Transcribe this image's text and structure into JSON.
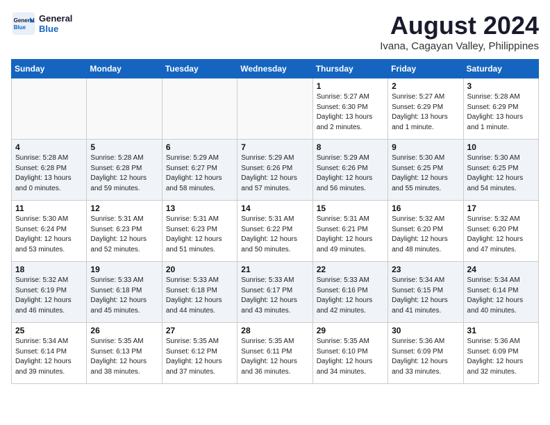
{
  "header": {
    "logo_line1": "General",
    "logo_line2": "Blue",
    "main_title": "August 2024",
    "subtitle": "Ivana, Cagayan Valley, Philippines"
  },
  "weekdays": [
    "Sunday",
    "Monday",
    "Tuesday",
    "Wednesday",
    "Thursday",
    "Friday",
    "Saturday"
  ],
  "weeks": [
    [
      {
        "day": "",
        "info": ""
      },
      {
        "day": "",
        "info": ""
      },
      {
        "day": "",
        "info": ""
      },
      {
        "day": "",
        "info": ""
      },
      {
        "day": "1",
        "info": "Sunrise: 5:27 AM\nSunset: 6:30 PM\nDaylight: 13 hours\nand 2 minutes."
      },
      {
        "day": "2",
        "info": "Sunrise: 5:27 AM\nSunset: 6:29 PM\nDaylight: 13 hours\nand 1 minute."
      },
      {
        "day": "3",
        "info": "Sunrise: 5:28 AM\nSunset: 6:29 PM\nDaylight: 13 hours\nand 1 minute."
      }
    ],
    [
      {
        "day": "4",
        "info": "Sunrise: 5:28 AM\nSunset: 6:28 PM\nDaylight: 13 hours\nand 0 minutes."
      },
      {
        "day": "5",
        "info": "Sunrise: 5:28 AM\nSunset: 6:28 PM\nDaylight: 12 hours\nand 59 minutes."
      },
      {
        "day": "6",
        "info": "Sunrise: 5:29 AM\nSunset: 6:27 PM\nDaylight: 12 hours\nand 58 minutes."
      },
      {
        "day": "7",
        "info": "Sunrise: 5:29 AM\nSunset: 6:26 PM\nDaylight: 12 hours\nand 57 minutes."
      },
      {
        "day": "8",
        "info": "Sunrise: 5:29 AM\nSunset: 6:26 PM\nDaylight: 12 hours\nand 56 minutes."
      },
      {
        "day": "9",
        "info": "Sunrise: 5:30 AM\nSunset: 6:25 PM\nDaylight: 12 hours\nand 55 minutes."
      },
      {
        "day": "10",
        "info": "Sunrise: 5:30 AM\nSunset: 6:25 PM\nDaylight: 12 hours\nand 54 minutes."
      }
    ],
    [
      {
        "day": "11",
        "info": "Sunrise: 5:30 AM\nSunset: 6:24 PM\nDaylight: 12 hours\nand 53 minutes."
      },
      {
        "day": "12",
        "info": "Sunrise: 5:31 AM\nSunset: 6:23 PM\nDaylight: 12 hours\nand 52 minutes."
      },
      {
        "day": "13",
        "info": "Sunrise: 5:31 AM\nSunset: 6:23 PM\nDaylight: 12 hours\nand 51 minutes."
      },
      {
        "day": "14",
        "info": "Sunrise: 5:31 AM\nSunset: 6:22 PM\nDaylight: 12 hours\nand 50 minutes."
      },
      {
        "day": "15",
        "info": "Sunrise: 5:31 AM\nSunset: 6:21 PM\nDaylight: 12 hours\nand 49 minutes."
      },
      {
        "day": "16",
        "info": "Sunrise: 5:32 AM\nSunset: 6:20 PM\nDaylight: 12 hours\nand 48 minutes."
      },
      {
        "day": "17",
        "info": "Sunrise: 5:32 AM\nSunset: 6:20 PM\nDaylight: 12 hours\nand 47 minutes."
      }
    ],
    [
      {
        "day": "18",
        "info": "Sunrise: 5:32 AM\nSunset: 6:19 PM\nDaylight: 12 hours\nand 46 minutes."
      },
      {
        "day": "19",
        "info": "Sunrise: 5:33 AM\nSunset: 6:18 PM\nDaylight: 12 hours\nand 45 minutes."
      },
      {
        "day": "20",
        "info": "Sunrise: 5:33 AM\nSunset: 6:18 PM\nDaylight: 12 hours\nand 44 minutes."
      },
      {
        "day": "21",
        "info": "Sunrise: 5:33 AM\nSunset: 6:17 PM\nDaylight: 12 hours\nand 43 minutes."
      },
      {
        "day": "22",
        "info": "Sunrise: 5:33 AM\nSunset: 6:16 PM\nDaylight: 12 hours\nand 42 minutes."
      },
      {
        "day": "23",
        "info": "Sunrise: 5:34 AM\nSunset: 6:15 PM\nDaylight: 12 hours\nand 41 minutes."
      },
      {
        "day": "24",
        "info": "Sunrise: 5:34 AM\nSunset: 6:14 PM\nDaylight: 12 hours\nand 40 minutes."
      }
    ],
    [
      {
        "day": "25",
        "info": "Sunrise: 5:34 AM\nSunset: 6:14 PM\nDaylight: 12 hours\nand 39 minutes."
      },
      {
        "day": "26",
        "info": "Sunrise: 5:35 AM\nSunset: 6:13 PM\nDaylight: 12 hours\nand 38 minutes."
      },
      {
        "day": "27",
        "info": "Sunrise: 5:35 AM\nSunset: 6:12 PM\nDaylight: 12 hours\nand 37 minutes."
      },
      {
        "day": "28",
        "info": "Sunrise: 5:35 AM\nSunset: 6:11 PM\nDaylight: 12 hours\nand 36 minutes."
      },
      {
        "day": "29",
        "info": "Sunrise: 5:35 AM\nSunset: 6:10 PM\nDaylight: 12 hours\nand 34 minutes."
      },
      {
        "day": "30",
        "info": "Sunrise: 5:36 AM\nSunset: 6:09 PM\nDaylight: 12 hours\nand 33 minutes."
      },
      {
        "day": "31",
        "info": "Sunrise: 5:36 AM\nSunset: 6:09 PM\nDaylight: 12 hours\nand 32 minutes."
      }
    ]
  ]
}
